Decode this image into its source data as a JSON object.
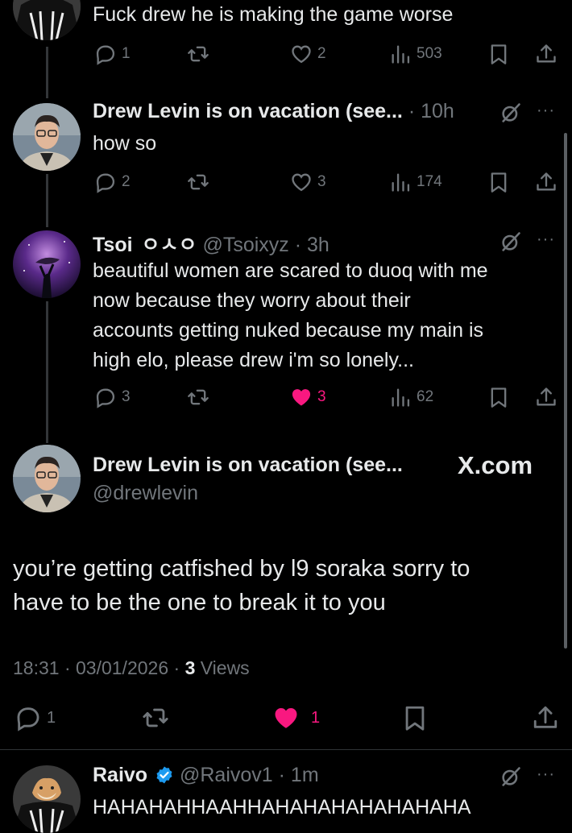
{
  "thread": [
    {
      "text": "Fuck drew he is making the game worse",
      "counts": {
        "replies": "1",
        "likes": "2",
        "views": "503"
      }
    },
    {
      "name": "Drew Levin is on vacation (see...",
      "meta": "· 10h",
      "text": "how so",
      "counts": {
        "replies": "2",
        "likes": "3",
        "views": "174"
      }
    },
    {
      "name": "Tsoi",
      "name_badge": "ㅇㅅㅇ",
      "meta": "@Tsoixyz · 3h",
      "text_lines": [
        "beautiful women are scared to duoq with me",
        "now because they worry about their",
        "accounts getting nuked because my main is",
        "high elo, please drew i'm so lonely..."
      ],
      "counts": {
        "replies": "3",
        "likes": "3",
        "views": "62"
      },
      "liked": true
    }
  ],
  "main": {
    "name": "Drew Levin is on vacation (see...",
    "handle": "@drewlevin",
    "source": "X.com",
    "text_lines": [
      "you’re getting catfished by l9 soraka sorry to",
      "have to be the one to break it to you"
    ],
    "time": "18:31 · 03/01/2026 ·",
    "views_count": "3",
    "views_label": "Views",
    "counts": {
      "replies": "1",
      "likes": "1"
    },
    "liked": true
  },
  "reply": {
    "name": "Raivo",
    "meta": "@Raivov1 · 1m",
    "text": "HAHAHAHHAAHHAHAHAHAHAHAHAHA"
  },
  "colors": {
    "background": "#000000",
    "text": "#e7e9ea",
    "muted": "#71767b",
    "like": "#f91880",
    "verified": "#1d9bf0"
  },
  "icons": [
    "reply-icon",
    "retweet-icon",
    "like-icon",
    "views-icon",
    "bookmark-icon",
    "share-icon",
    "grok-icon",
    "more-icon",
    "verified-icon"
  ]
}
